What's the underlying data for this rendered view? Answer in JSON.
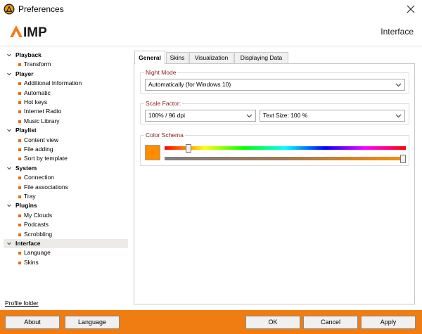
{
  "window": {
    "title": "Preferences"
  },
  "header": {
    "logo_text": "AIMP",
    "section_title": "Interface"
  },
  "tree": [
    {
      "label": "Playback",
      "items": [
        "Transform"
      ]
    },
    {
      "label": "Player",
      "items": [
        "Additional Information",
        "Automatic",
        "Hot keys",
        "Internet Radio",
        "Music Library"
      ]
    },
    {
      "label": "Playlist",
      "items": [
        "Content view",
        "File adding",
        "Sort by template"
      ]
    },
    {
      "label": "System",
      "items": [
        "Connection",
        "File associations",
        "Tray"
      ]
    },
    {
      "label": "Plugins",
      "items": [
        "My Clouds",
        "Podcasts",
        "Scrobbling"
      ]
    },
    {
      "label": "Interface",
      "items": [
        "Language",
        "Skins"
      ],
      "selected": true
    }
  ],
  "tabs": [
    "General",
    "Skins",
    "Visualization",
    "Displaying Data"
  ],
  "active_tab": "General",
  "night_mode": {
    "label": "Night Mode",
    "value": "Automatically (for Windows 10)"
  },
  "scale_factor": {
    "label": "Scale Factor:",
    "value": "100% / 96 dpi",
    "text_size": "Text Size: 100 %"
  },
  "color_schema": {
    "label": "Color Schema",
    "color": "#ff8c00",
    "hue_position": 0.1,
    "shade_position": 1.0
  },
  "footer": {
    "profile_link": "Profile folder",
    "about": "About",
    "language": "Language",
    "ok": "OK",
    "cancel": "Cancel",
    "apply": "Apply"
  },
  "colors": {
    "accent": "#f07d12",
    "group_label": "#8b1a1a",
    "bullet": "#f26800"
  }
}
